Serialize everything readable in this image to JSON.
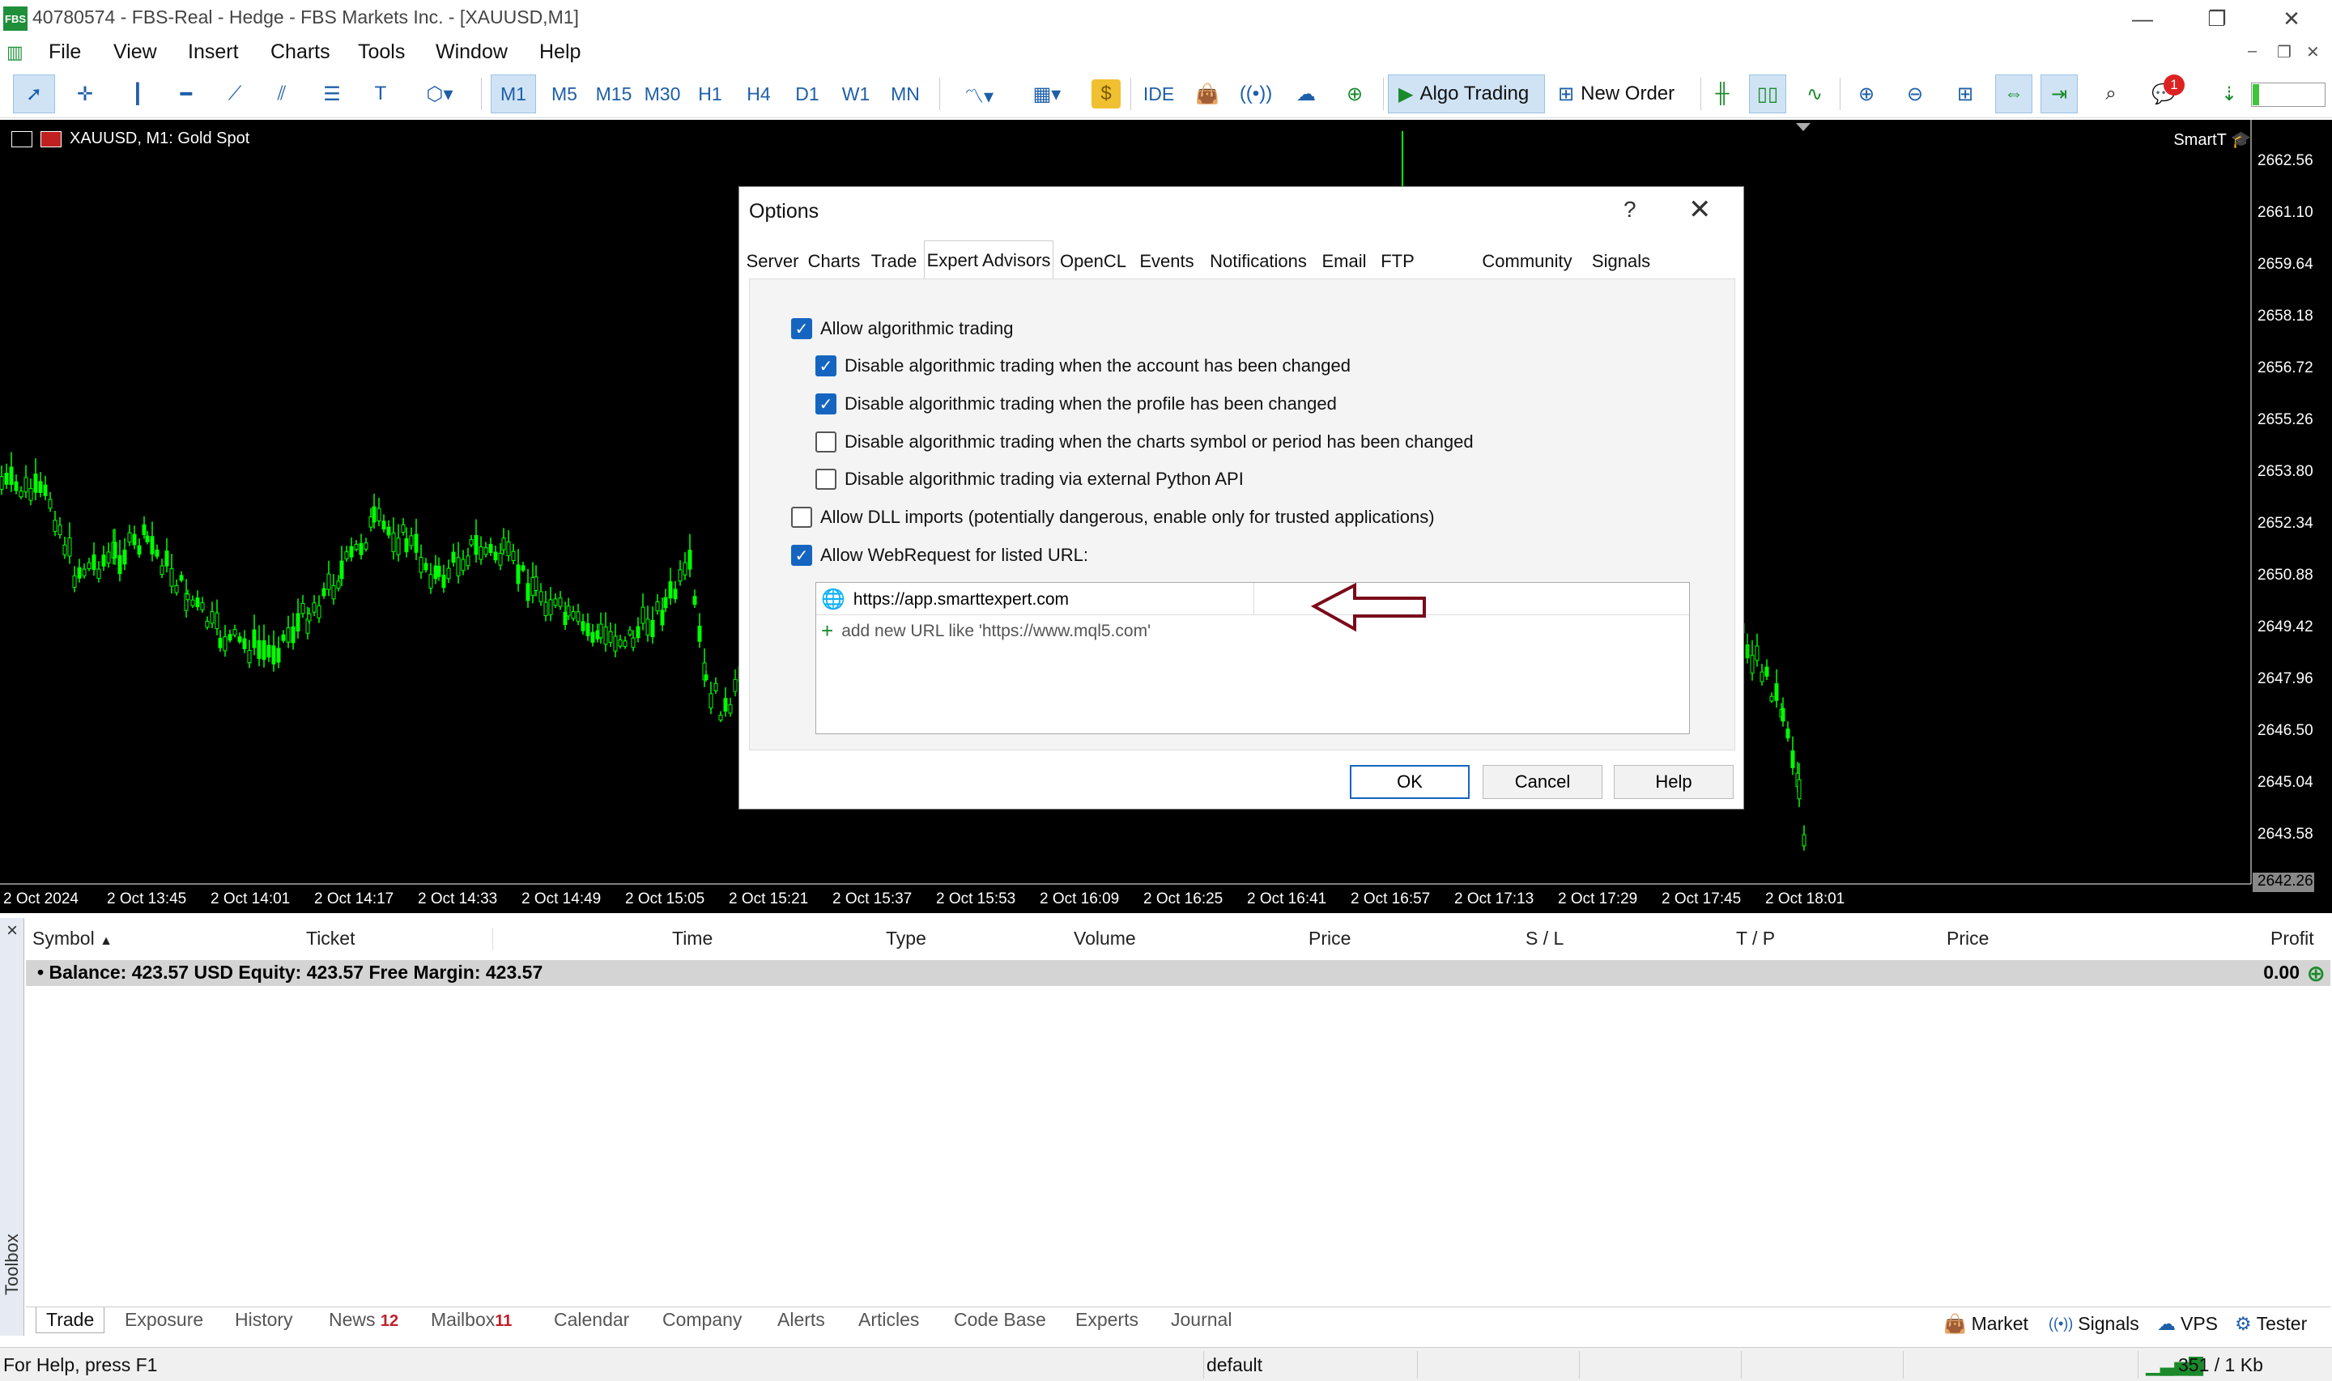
{
  "window": {
    "title": "40780574 - FBS-Real - Hedge - FBS Markets Inc. - [XAUUSD,M1]",
    "logo": "FBS"
  },
  "menu": [
    "File",
    "View",
    "Insert",
    "Charts",
    "Tools",
    "Window",
    "Help"
  ],
  "toolbar": {
    "timeframes": [
      "M1",
      "M5",
      "M15",
      "M30",
      "H1",
      "H4",
      "D1",
      "W1",
      "MN"
    ],
    "active_timeframe": "M1",
    "ide_label": "IDE",
    "algo_trading_label": "Algo Trading",
    "new_order_label": "New Order",
    "notification_count": "1"
  },
  "chart": {
    "title": "XAUUSD, M1:  Gold Spot",
    "expert_label": "SmartT",
    "price_labels": [
      "2662.56",
      "2661.10",
      "2659.64",
      "2658.18",
      "2656.72",
      "2655.26",
      "2653.80",
      "2652.34",
      "2650.88",
      "2649.42",
      "2647.96",
      "2646.50",
      "2645.04",
      "2643.58"
    ],
    "current_price": "2642.26",
    "time_labels": [
      "2 Oct 2024",
      "2 Oct 13:45",
      "2 Oct 14:01",
      "2 Oct 14:17",
      "2 Oct 14:33",
      "2 Oct 14:49",
      "2 Oct 15:05",
      "2 Oct 15:21",
      "2 Oct 15:37",
      "2 Oct 15:53",
      "2 Oct 16:09",
      "2 Oct 16:25",
      "2 Oct 16:41",
      "2 Oct 16:57",
      "2 Oct 17:13",
      "2 Oct 17:29",
      "2 Oct 17:45",
      "2 Oct 18:01"
    ],
    "colors": {
      "background": "#000000",
      "candles": "#00ff00"
    }
  },
  "dialog": {
    "title": "Options",
    "help_glyph": "?",
    "close_glyph": "✕",
    "tabs": [
      "Server",
      "Charts",
      "Trade",
      "Expert Advisors",
      "OpenCL",
      "Events",
      "Notifications",
      "Email",
      "FTP",
      "Community",
      "Signals"
    ],
    "selected_tab": "Expert Advisors",
    "options": [
      {
        "label": "Allow algorithmic trading",
        "checked": true,
        "indent": 0
      },
      {
        "label": "Disable algorithmic trading when the account has been changed",
        "checked": true,
        "indent": 1
      },
      {
        "label": "Disable algorithmic trading when the profile has been changed",
        "checked": true,
        "indent": 1
      },
      {
        "label": "Disable algorithmic trading when the charts symbol or period has been changed",
        "checked": false,
        "indent": 1
      },
      {
        "label": "Disable algorithmic trading via external Python API",
        "checked": false,
        "indent": 1
      },
      {
        "label": "Allow DLL imports (potentially dangerous, enable only for trusted applications)",
        "checked": false,
        "indent": 0
      },
      {
        "label": "Allow WebRequest for listed URL:",
        "checked": true,
        "indent": 0
      }
    ],
    "urls": [
      "https://app.smarttexpert.com"
    ],
    "add_url_hint": "add new URL like 'https://www.mql5.com'",
    "buttons": {
      "ok": "OK",
      "cancel": "Cancel",
      "help": "Help"
    }
  },
  "toolbox": {
    "side_label": "Toolbox",
    "close_glyph": "×",
    "columns": [
      "Symbol",
      "Ticket",
      "Time",
      "Type",
      "Volume",
      "Price",
      "S / L",
      "T / P",
      "Price",
      "Profit"
    ],
    "balance_text": "Balance: 423.57 USD  Equity: 423.57  Free Margin: 423.57",
    "profit_value": "0.00",
    "tabs": [
      {
        "label": "Trade",
        "badge": ""
      },
      {
        "label": "Exposure",
        "badge": ""
      },
      {
        "label": "History",
        "badge": ""
      },
      {
        "label": "News",
        "badge": "12"
      },
      {
        "label": "Mailbox",
        "badge": "11"
      },
      {
        "label": "Calendar",
        "badge": ""
      },
      {
        "label": "Company",
        "badge": ""
      },
      {
        "label": "Alerts",
        "badge": ""
      },
      {
        "label": "Articles",
        "badge": ""
      },
      {
        "label": "Code Base",
        "badge": ""
      },
      {
        "label": "Experts",
        "badge": ""
      },
      {
        "label": "Journal",
        "badge": ""
      }
    ],
    "right_tabs": [
      "Market",
      "Signals",
      "VPS",
      "Tester"
    ]
  },
  "status": {
    "help": "For Help, press F1",
    "profile": "default",
    "traffic": "351 / 1 Kb"
  }
}
